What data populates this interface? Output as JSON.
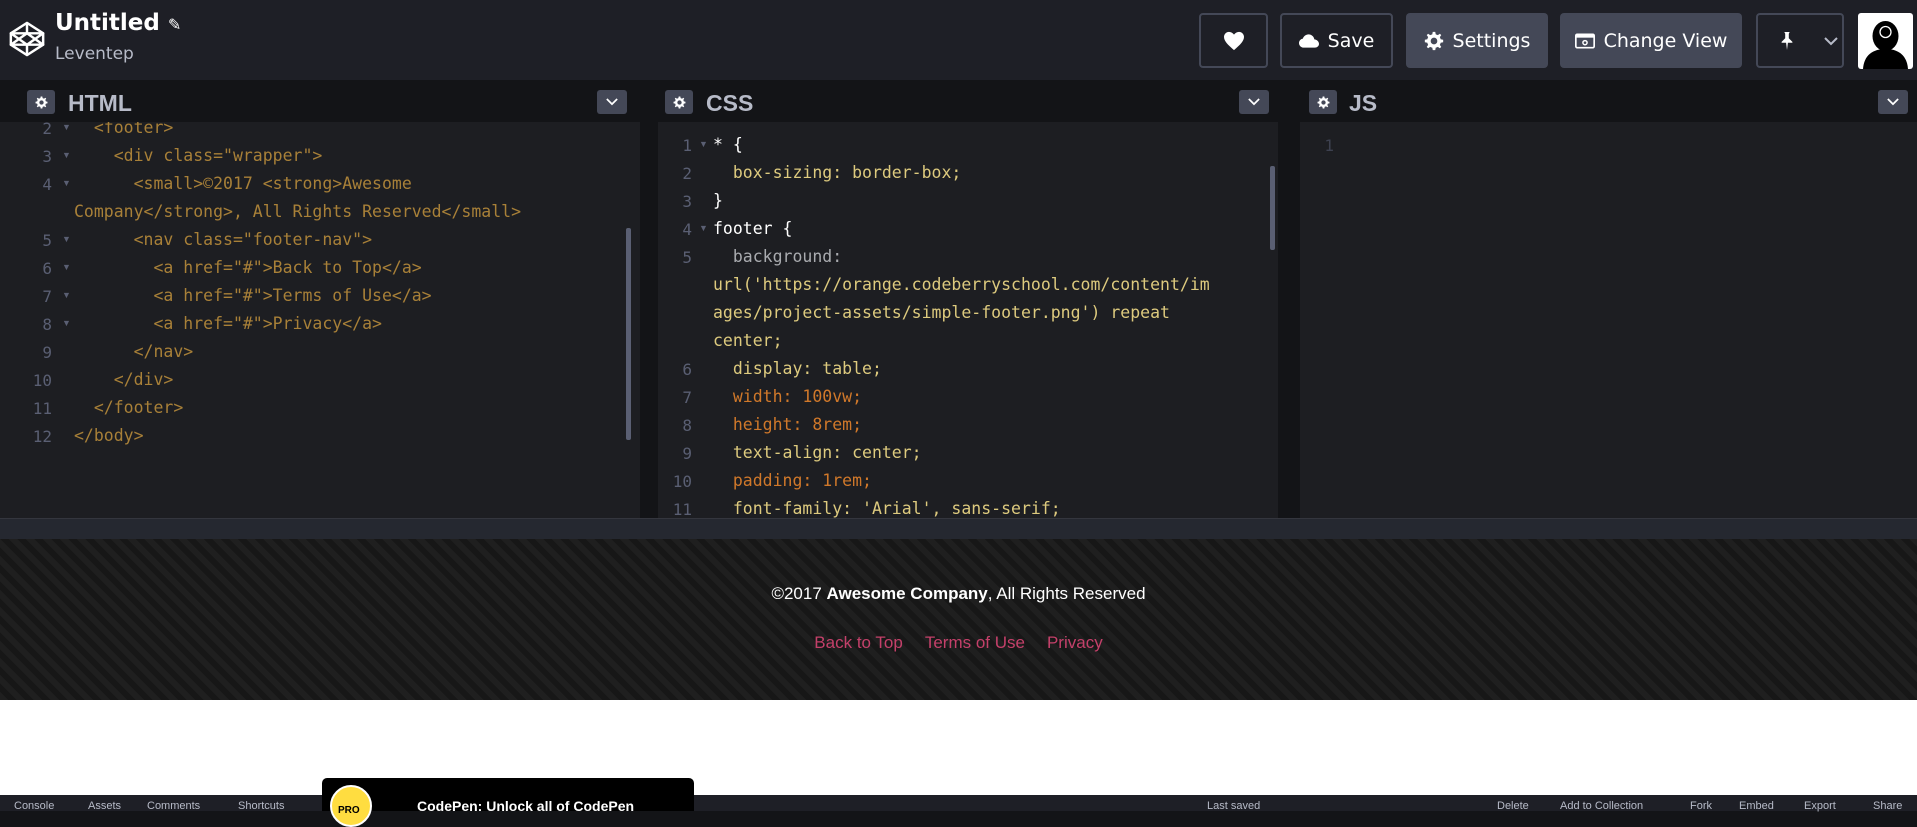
{
  "header": {
    "title": "Untitled",
    "author": "Leventep",
    "buttons": {
      "save": "Save",
      "settings": "Settings",
      "change_view": "Change View"
    }
  },
  "panes": {
    "html": {
      "title": "HTML"
    },
    "css": {
      "title": "CSS"
    },
    "js": {
      "title": "JS"
    }
  },
  "html_code": {
    "line_numbers": [
      "2",
      "3",
      "4",
      "5",
      "6",
      "7",
      "8",
      "9",
      "10",
      "11",
      "12"
    ],
    "lines": [
      "  <footer>",
      "    <div class=\"wrapper\">",
      "      <small>©2017 <strong>Awesome",
      "Company</strong>, All Rights Reserved</small>",
      "      <nav class=\"footer-nav\">",
      "        <a href=\"#\">Back to Top</a>",
      "        <a href=\"#\">Terms of Use</a>",
      "        <a href=\"#\">Privacy</a>",
      "      </nav>",
      "    </div>",
      "  </footer>",
      "</body>"
    ]
  },
  "css_code": {
    "line_numbers": [
      "1",
      "2",
      "3",
      "4",
      "5",
      "6",
      "7",
      "8",
      "9",
      "10",
      "11"
    ],
    "lines": [
      "* {",
      "  box-sizing: border-box;",
      "}",
      "footer {",
      "  background:",
      "url('https://orange.codeberryschool.com/content/im",
      "ages/project-assets/simple-footer.png') repeat",
      "center;",
      "  display: table;",
      "  width: 100vw;",
      "  height: 8rem;",
      "  text-align: center;",
      "  padding: 1rem;",
      "  font-family: 'Arial', sans-serif;"
    ]
  },
  "js_code": {
    "line_numbers": [
      "1"
    ]
  },
  "preview": {
    "copyright_prefix": "©2017 ",
    "company": "Awesome Company",
    "copyright_suffix": ", All Rights Reserved",
    "nav": [
      "Back to Top",
      "Terms of Use",
      "Privacy"
    ]
  },
  "promo": {
    "badge": "PRO",
    "text": "CodePen: Unlock all of CodePen"
  },
  "bottombar": {
    "items": [
      "Console",
      "Assets",
      "Comments",
      "Shortcuts",
      "Last saved",
      "Delete",
      "Add to Collection",
      "Fork",
      "Embed",
      "Export",
      "Share"
    ]
  },
  "colors": {
    "accent_link": "#c4406a",
    "topbar_bg": "#1e1f26",
    "button_bg": "#444857"
  }
}
